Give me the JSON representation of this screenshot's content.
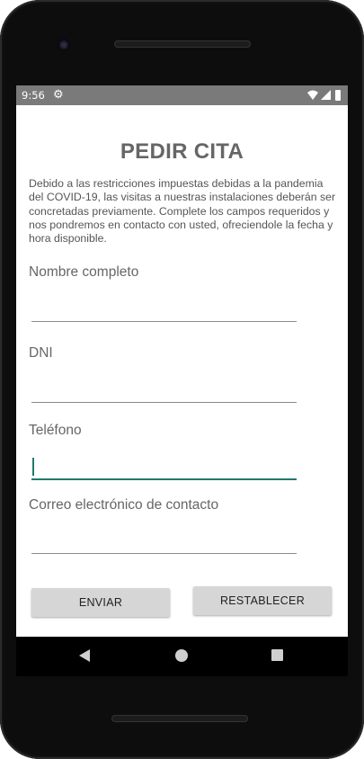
{
  "status_bar": {
    "time": "9:56",
    "icons": [
      "gear-icon",
      "wifi-icon",
      "signal-icon",
      "battery-icon"
    ]
  },
  "page": {
    "title": "PEDIR CITA",
    "intro": "Debido a las restricciones impuestas debidas a la pandemia del COVID-19, las visitas a nuestras instalaciones deberán ser concretadas previamente. Complete los campos requeridos y nos pondremos en contacto con usted, ofreciendole la fecha y hora disponible."
  },
  "form": {
    "fields": [
      {
        "label": "Nombre completo",
        "value": ""
      },
      {
        "label": "DNI",
        "value": ""
      },
      {
        "label": "Teléfono",
        "value": "",
        "focused": true
      },
      {
        "label": "Correo electrónico de contacto",
        "value": ""
      }
    ],
    "send_label": "ENVIAR",
    "reset_label": "RESTABLECER"
  },
  "nav": {
    "icons": [
      "back-icon",
      "home-icon",
      "recent-apps-icon"
    ]
  },
  "colors": {
    "accent": "#1f7a6c",
    "status_bar": "#7a7a7a",
    "button": "#d6d6d6",
    "title": "#666666"
  }
}
